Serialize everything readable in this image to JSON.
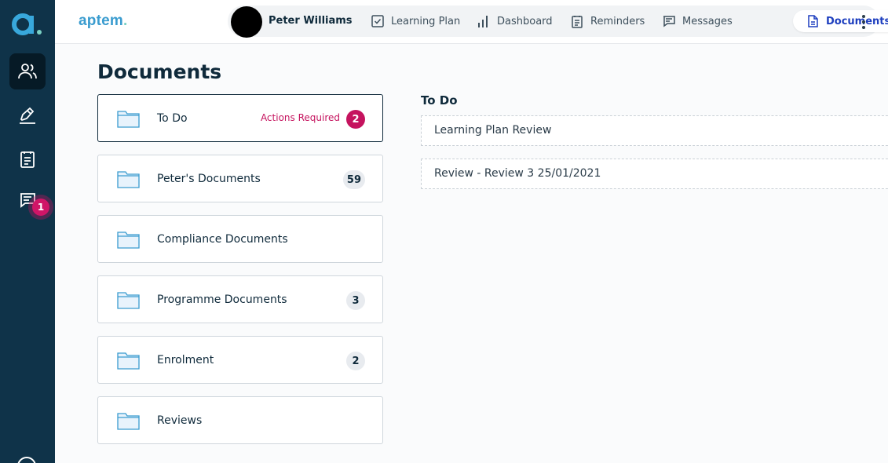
{
  "brand": {
    "name": "aptem",
    "dot": "."
  },
  "user": {
    "name": "Peter Williams"
  },
  "nav": [
    {
      "label": "Learning Plan",
      "icon": "checkbox-icon"
    },
    {
      "label": "Dashboard",
      "icon": "bar-chart-icon"
    },
    {
      "label": "Reminders",
      "icon": "clipboard-icon"
    },
    {
      "label": "Messages",
      "icon": "message-icon"
    },
    {
      "label": "Documents",
      "icon": "document-icon",
      "active": true
    }
  ],
  "rail": {
    "messages_badge": "1"
  },
  "page": {
    "title": "Documents"
  },
  "folders": [
    {
      "label": "To Do",
      "actions_text": "Actions Required",
      "count": "2",
      "alert": true
    },
    {
      "label": "Peter's Documents",
      "count": "59"
    },
    {
      "label": "Compliance Documents"
    },
    {
      "label": "Programme Documents",
      "count": "3"
    },
    {
      "label": "Enrolment",
      "count": "2"
    },
    {
      "label": "Reviews"
    }
  ],
  "todo": {
    "title": "To Do",
    "items": [
      "Learning Plan Review",
      "Review - Review 3 25/01/2021"
    ]
  },
  "colors": {
    "rail": "#0f3349",
    "accent": "#1e3fbf",
    "alert": "#c5135e",
    "brand": "#3a9ccf"
  }
}
